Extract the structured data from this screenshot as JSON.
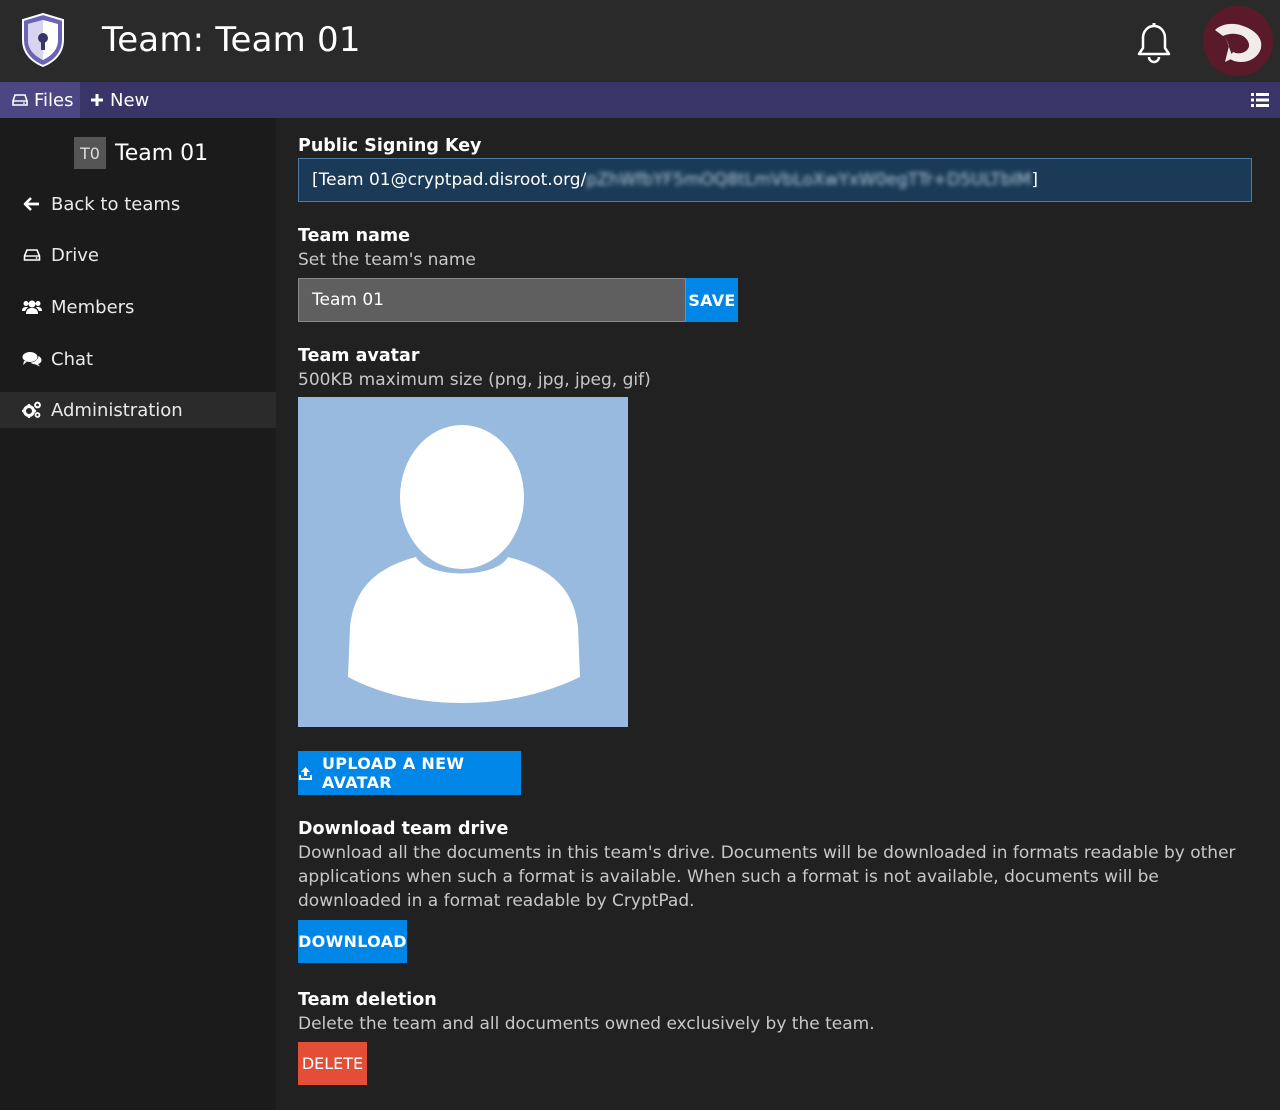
{
  "header": {
    "title": "Team: Team 01",
    "logo_icon": "cryptpad-shield-logo",
    "notifications_icon": "bell-icon",
    "avatar_color": "#5a1a2a"
  },
  "toolbar": {
    "files_label": "Files",
    "new_label": "New",
    "menu_icon": "list-icon",
    "bg_color": "#3a3569"
  },
  "sidebar": {
    "team_initials": "T0",
    "team_name": "Team 01",
    "items": [
      {
        "label": "Back to teams",
        "icon": "arrow-left-icon"
      },
      {
        "label": "Drive",
        "icon": "drive-icon"
      },
      {
        "label": "Members",
        "icon": "users-icon"
      },
      {
        "label": "Chat",
        "icon": "comments-icon"
      },
      {
        "label": "Administration",
        "icon": "cogs-icon",
        "active": true
      }
    ]
  },
  "main": {
    "signing_key": {
      "title": "Public Signing Key",
      "value_visible": "[Team 01@cryptpad.disroot.org/",
      "value_redacted": "pZhWfbYF5mOQ8tLmVbLoXwYxW0egTTr+D5ULTbIM",
      "value_end": "]"
    },
    "team_name": {
      "title": "Team name",
      "description": "Set the team's name",
      "value": "Team 01",
      "save_label": "SAVE"
    },
    "team_avatar": {
      "title": "Team avatar",
      "description": "500KB maximum size (png, jpg, jpeg, gif)",
      "upload_label": "UPLOAD A NEW AVATAR",
      "placeholder_color": "#97bade"
    },
    "download": {
      "title": "Download team drive",
      "description": "Download all the documents in this team's drive. Documents will be downloaded in formats readable by other applications when such a format is available. When such a format is not available, documents will be downloaded in a format readable by CryptPad.",
      "button_label": "DOWNLOAD"
    },
    "deletion": {
      "title": "Team deletion",
      "description": "Delete the team and all documents owned exclusively by the team.",
      "button_label": "DELETE",
      "button_color": "#e24e36"
    }
  },
  "colors": {
    "accent": "#0086e6",
    "danger": "#e24e36",
    "background": "#212121",
    "sidebar": "#1b1b1b"
  }
}
